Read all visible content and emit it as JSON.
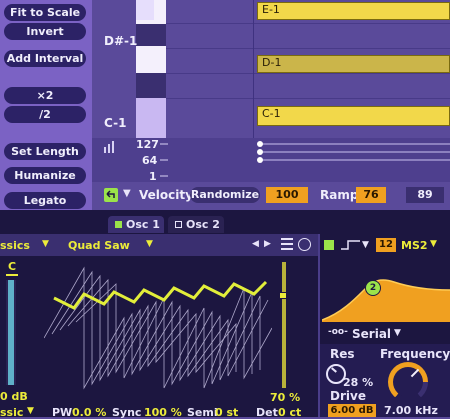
{
  "left_panel": {
    "buttons": [
      "Fit to Scale",
      "Invert",
      "Add Interval",
      "×2",
      "/2",
      "Set Length",
      "Humanize",
      "Legato"
    ]
  },
  "piano_roll": {
    "pitch_labels": [
      "D#-1",
      "C-1"
    ],
    "notes": [
      {
        "label": "E-1",
        "style": "bright"
      },
      {
        "label": "D-1",
        "style": "dim"
      },
      {
        "label": "C-1",
        "style": "bright"
      }
    ],
    "velocity_ticks": [
      "127",
      "64",
      "1"
    ]
  },
  "velocity_bar": {
    "label": "Velocity",
    "randomize_label": "Randomize",
    "randomize_value": "100",
    "ramp_label": "Ramp",
    "ramp_start": "76",
    "ramp_end": "89"
  },
  "synth": {
    "tabs": [
      "Osc 1",
      "Osc 2"
    ],
    "category": "ssics",
    "wave": "Quad Saw",
    "note": "C",
    "left_level": "0 dB",
    "right_level": "70 %",
    "bottom_params": {
      "mode": "ssic",
      "pw_label": "PW",
      "pw_value": "0.0 %",
      "sync_label": "Sync",
      "sync_value": "100 %",
      "semi_label": "Semi",
      "semi_value": "0 st",
      "det_label": "Det",
      "det_value": "0 ct"
    },
    "filter": {
      "type_num": "12",
      "model": "MS2",
      "node": "2",
      "routing": "Serial",
      "res_label": "Res",
      "res_value": "28 %",
      "drive_label": "Drive",
      "drive_value": "6.00 dB",
      "freq_label": "Frequency",
      "freq_value": "7.00 kHz"
    }
  },
  "colors": {
    "note_bright": "#f2d84a",
    "note_dim": "#cbb54a",
    "accent_green": "#9be34a",
    "accent_orange": "#f0a020",
    "wave_yellow": "#e2ee3a"
  }
}
